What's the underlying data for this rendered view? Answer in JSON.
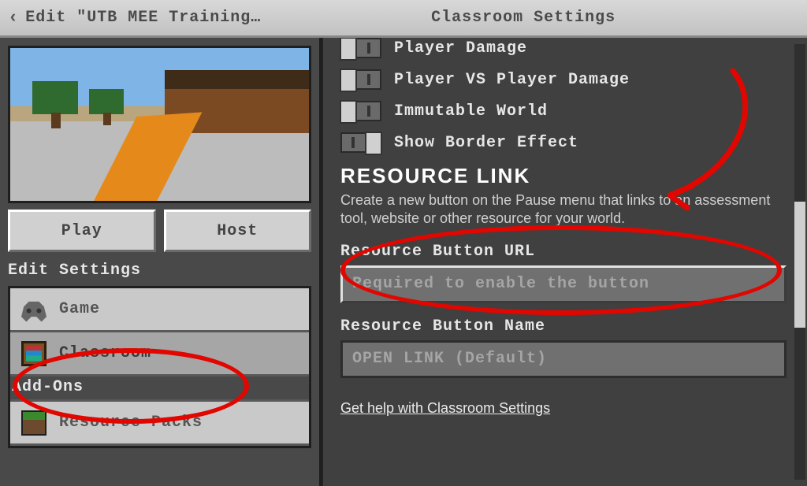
{
  "header": {
    "back_label": "Edit \"UTB MEE Training…",
    "center_label": "Classroom Settings"
  },
  "left": {
    "play_label": "Play",
    "host_label": "Host",
    "edit_settings_label": "Edit Settings",
    "items": {
      "game": "Game",
      "classroom": "Classroom",
      "resource_packs": "Resource Packs"
    },
    "addons_label": "Add-Ons"
  },
  "right": {
    "toggles": {
      "player_damage": "Player Damage",
      "pvp": "Player VS Player Damage",
      "immutable": "Immutable World",
      "border": "Show Border Effect"
    },
    "resource_link_head": "RESOURCE LINK",
    "resource_link_desc": "Create a new button on the Pause menu that links to an assessment tool, website or other resource for your world.",
    "url_label": "Resource Button URL",
    "url_placeholder": "Required to enable the button",
    "name_label": "Resource Button Name",
    "name_placeholder": "OPEN LINK (Default)",
    "help_label": "Get help with Classroom Settings"
  }
}
